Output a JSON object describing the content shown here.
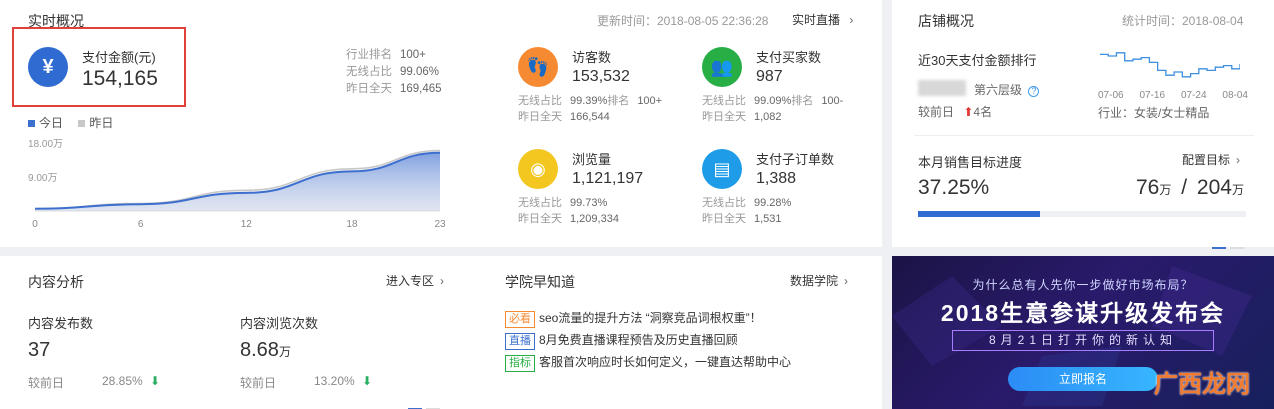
{
  "realtime": {
    "title": "实时概况",
    "update_time": "更新时间：2018-08-05 22:36:28",
    "live_link": "实时直播",
    "pay": {
      "label": "支付金额(元)",
      "value": "154,165",
      "rank_label": "行业排名",
      "rank_value": "100+",
      "wireless_label": "无线占比",
      "wireless_value": "99.06%",
      "yesterday_label": "昨日全天",
      "yesterday_value": "169,465"
    },
    "legend_today": "今日",
    "legend_yesterday": "昨日",
    "y_labels": [
      "18.00万",
      "9.00万"
    ],
    "x_labels": [
      "0",
      "6",
      "12",
      "18",
      "23"
    ],
    "metrics": [
      {
        "label": "访客数",
        "value": "153,532",
        "l1": "无线占比",
        "v1": "99.39%",
        "l2": "排名",
        "v2": "100+",
        "l3": "昨日全天",
        "v3": "166,544",
        "color": "#f58a33"
      },
      {
        "label": "支付买家数",
        "value": "987",
        "l1": "无线占比",
        "v1": "99.09%",
        "l2": "排名",
        "v2": "100-",
        "l3": "昨日全天",
        "v3": "1,082",
        "color": "#27ae45"
      },
      {
        "label": "浏览量",
        "value": "1,121,197",
        "l1": "无线占比",
        "v1": "99.73%",
        "l2": "",
        "v2": "",
        "l3": "昨日全天",
        "v3": "1,209,334",
        "color": "#f3c620"
      },
      {
        "label": "支付子订单数",
        "value": "1,388",
        "l1": "无线占比",
        "v1": "99.28%",
        "l2": "",
        "v2": "",
        "l3": "昨日全天",
        "v3": "1,531",
        "color": "#1e9ce8"
      }
    ]
  },
  "chart_data": {
    "type": "area",
    "x": [
      0,
      6,
      12,
      18,
      23
    ],
    "ylim": [
      0,
      180000
    ],
    "y_ticks": [
      "18.00万",
      "9.00万"
    ],
    "series": [
      {
        "name": "今日",
        "values": [
          6000,
          18000,
          48000,
          105000,
          154165
        ],
        "color": "#3d6fcf"
      },
      {
        "name": "昨日",
        "values": [
          6500,
          20000,
          55000,
          112000,
          160000
        ],
        "color": "#c8c8c8"
      }
    ]
  },
  "shop": {
    "title": "店铺概况",
    "stat_time": "统计时间：2018-08-04",
    "rank_title": "近30天支付金额排行",
    "level": "第六层级",
    "compare_label": "较前日",
    "compare_value": "4名",
    "spark_labels": [
      "07-06",
      "07-16",
      "07-24",
      "08-04"
    ],
    "industry": "行业：女装/女士精品",
    "target_title": "本月销售目标进度",
    "target_link": "配置目标",
    "target_percent": "37.25%",
    "target_progress": 0.3725,
    "target_current": "76",
    "target_total": "204",
    "unit": "万",
    "separator": "/",
    "spark": [
      0.2,
      0.25,
      0.15,
      0.4,
      0.35,
      0.3,
      0.45,
      0.7,
      0.85,
      0.75,
      0.9,
      0.8,
      0.65,
      0.7,
      0.6,
      0.55,
      0.65,
      0.5
    ]
  },
  "content": {
    "title": "内容分析",
    "link": "进入专区",
    "publish_label": "内容发布数",
    "publish_value": "37",
    "views_label": "内容浏览次数",
    "views_value": "8.68",
    "views_unit": "万",
    "compare_label": "较前日",
    "publish_change": "28.85%",
    "views_change": "13.20%"
  },
  "academy": {
    "title": "学院早知道",
    "link": "数据学院",
    "items": [
      {
        "tag": "必看",
        "tag_color": "#f58a33",
        "text": "seo流量的提升方法 “洞察竞品词根权重”！"
      },
      {
        "tag": "直播",
        "tag_color": "#3d6fcf",
        "text": "8月免费直播课程预告及历史直播回顾"
      },
      {
        "tag": "指标",
        "tag_color": "#27ae45",
        "text": "客服首次响应时长如何定义，一键直达帮助中心"
      }
    ]
  },
  "banner": {
    "subtitle": "为什么总有人先你一步做好市场布局？",
    "title": "2018生意参谋升级发布会",
    "date_line": "8月21日打开你的新认知",
    "button": "立即报名",
    "watermark": "广西龙网"
  }
}
